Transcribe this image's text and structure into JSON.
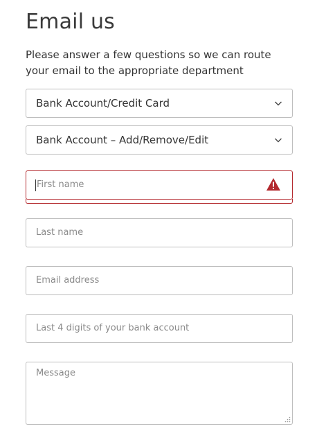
{
  "header": {
    "title": "Email us",
    "intro": "Please answer a few questions so we can route your email to the appropriate department"
  },
  "form": {
    "topic_select": {
      "value": "Bank Account/Credit Card",
      "icon": "chevron-down-icon"
    },
    "subtopic_select": {
      "value": "Bank Account – Add/Remove/Edit",
      "icon": "chevron-down-icon"
    },
    "first_name": {
      "placeholder": "First name",
      "value": "",
      "state": "error",
      "icon": "warning-icon"
    },
    "last_name": {
      "placeholder": "Last name",
      "value": ""
    },
    "email": {
      "placeholder": "Email address",
      "value": ""
    },
    "account_digits": {
      "placeholder": "Last 4 digits of your bank account",
      "value": ""
    },
    "message": {
      "placeholder": "Message",
      "value": "",
      "icon": "resize-handle-icon"
    }
  },
  "colors": {
    "text": "#333333",
    "placeholder": "#8a8a8a",
    "border": "#bdbdbd",
    "error": "#b3282d"
  }
}
